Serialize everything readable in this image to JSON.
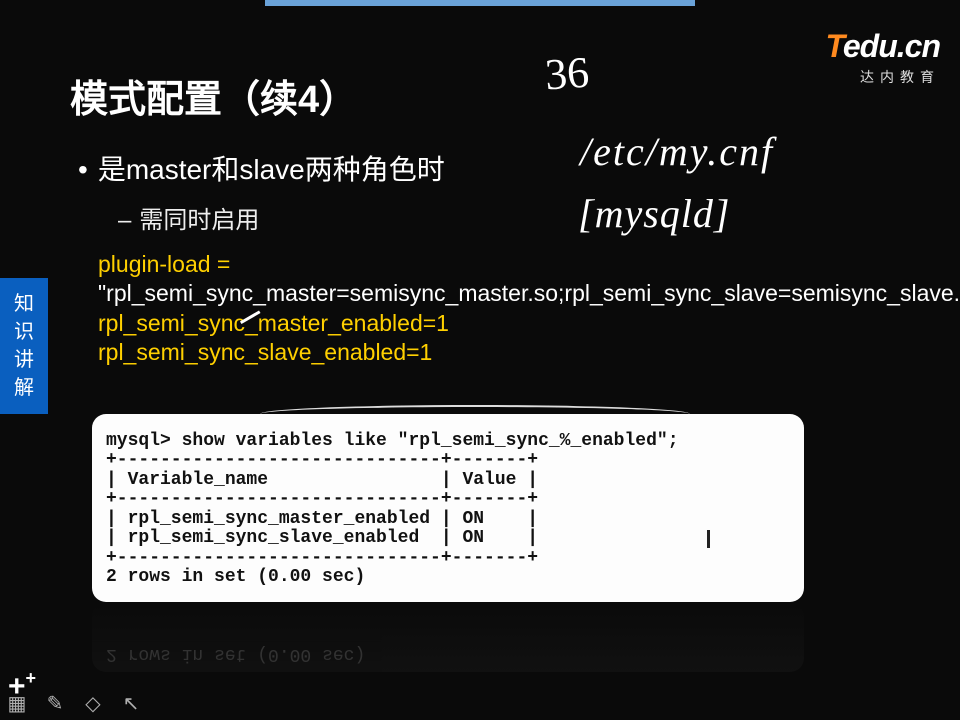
{
  "logo": {
    "brand_t": "T",
    "brand_rest": "edu.cn",
    "sub": "达内教育"
  },
  "side_tab": {
    "c1": "知",
    "c2": "识",
    "c3": "讲",
    "c4": "解"
  },
  "title": "模式配置（续4）",
  "bullet1": "是master和slave两种角色时",
  "bullet2": "需同时启用",
  "code": {
    "l1_y": "plugin-load = ",
    "l2_w": "\"rpl_semi_sync_master=semisync_master.so;rpl_semi_sync_slave=semisync_slave.so\"",
    "l3_y": "rpl_semi_sync_master_enabled=1",
    "l4_y": "rpl_semi_sync_slave_enabled=1"
  },
  "terminal": {
    "line1": "mysql> show variables like \"rpl_semi_sync_%_enabled\";",
    "line2": "+------------------------------+-------+",
    "line3": "| Variable_name                | Value |",
    "line4": "+------------------------------+-------+",
    "line5": "| rpl_semi_sync_master_enabled | ON    |",
    "line6": "| rpl_semi_sync_slave_enabled  | ON    |",
    "line7": "+------------------------------+-------+",
    "line8": "2 rows in set (0.00 sec)"
  },
  "hand": {
    "h1": "36",
    "h2": "/etc/my.cnf",
    "h3": "[mysqld]"
  },
  "toolbar": {
    "plus": "+",
    "grid": "▦",
    "pen": "✎",
    "erase": "◇",
    "cursor": "↖"
  }
}
